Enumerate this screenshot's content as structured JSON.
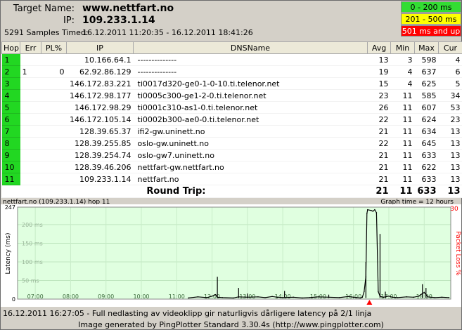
{
  "header": {
    "target_label": "Target Name:",
    "target_value": "www.nettfart.no",
    "ip_label": "IP:",
    "ip_value": "109.233.1.14",
    "samples_label": "5291 Samples Timed:",
    "samples_range": "16.12.2011 11:20:35 - 16.12.2011 18:41:26"
  },
  "legend": [
    {
      "label": "0 - 200 ms",
      "color": "#33dd33"
    },
    {
      "label": "201 - 500 ms",
      "color": "#ffff00"
    },
    {
      "label": "501 ms and up",
      "color": "#ff0000"
    }
  ],
  "table": {
    "columns": [
      "Hop",
      "Err",
      "PL%",
      "IP",
      "DNSName",
      "Avg",
      "Min",
      "Max",
      "Cur"
    ],
    "rows": [
      {
        "hop": "1",
        "err": "",
        "pl": "",
        "ip": "10.166.64.1",
        "dns": "--------------",
        "avg": "13",
        "min": "3",
        "max": "598",
        "cur": "4"
      },
      {
        "hop": "2",
        "err": "1",
        "pl": "0",
        "ip": "62.92.86.129",
        "dns": "--------------",
        "avg": "19",
        "min": "4",
        "max": "637",
        "cur": "6"
      },
      {
        "hop": "3",
        "err": "",
        "pl": "",
        "ip": "146.172.83.221",
        "dns": "ti0017d320-ge0-1-0-10.ti.telenor.net",
        "avg": "15",
        "min": "4",
        "max": "625",
        "cur": "5"
      },
      {
        "hop": "4",
        "err": "",
        "pl": "",
        "ip": "146.172.98.177",
        "dns": "ti0005c300-ge1-2-0.ti.telenor.net",
        "avg": "23",
        "min": "11",
        "max": "585",
        "cur": "34"
      },
      {
        "hop": "5",
        "err": "",
        "pl": "",
        "ip": "146.172.98.29",
        "dns": "ti0001c310-as1-0.ti.telenor.net",
        "avg": "26",
        "min": "11",
        "max": "607",
        "cur": "53"
      },
      {
        "hop": "6",
        "err": "",
        "pl": "",
        "ip": "146.172.105.14",
        "dns": "ti0002b300-ae0-0.ti.telenor.net",
        "avg": "22",
        "min": "11",
        "max": "624",
        "cur": "23"
      },
      {
        "hop": "7",
        "err": "",
        "pl": "",
        "ip": "128.39.65.37",
        "dns": "ifi2-gw.uninett.no",
        "avg": "21",
        "min": "11",
        "max": "634",
        "cur": "13"
      },
      {
        "hop": "8",
        "err": "",
        "pl": "",
        "ip": "128.39.255.85",
        "dns": "oslo-gw.uninett.no",
        "avg": "22",
        "min": "11",
        "max": "645",
        "cur": "13"
      },
      {
        "hop": "9",
        "err": "",
        "pl": "",
        "ip": "128.39.254.74",
        "dns": "oslo-gw7.uninett.no",
        "avg": "21",
        "min": "11",
        "max": "633",
        "cur": "13"
      },
      {
        "hop": "10",
        "err": "",
        "pl": "",
        "ip": "128.39.46.206",
        "dns": "nettfart-gw.nettfart.no",
        "avg": "21",
        "min": "11",
        "max": "622",
        "cur": "13"
      },
      {
        "hop": "11",
        "err": "",
        "pl": "",
        "ip": "109.233.1.14",
        "dns": "nettfart.no",
        "avg": "21",
        "min": "11",
        "max": "633",
        "cur": "13"
      }
    ],
    "round_trip": {
      "label": "Round Trip:",
      "avg": "21",
      "min": "11",
      "max": "633",
      "cur": "13"
    }
  },
  "graph": {
    "title": "nettfart.no (109.233.1.14) hop 11",
    "time_label": "Graph time = 12 hours",
    "right_axis_label": "Packet Loss %",
    "right_axis_max": "30",
    "right_color": "#ff0000",
    "bg_color": "#e0ffe0"
  },
  "chart_data": {
    "type": "line",
    "ylabel": "Latency (ms)",
    "y2label": "Packet Loss %",
    "ylim": [
      0,
      247
    ],
    "y2lim": [
      0,
      30
    ],
    "y_ticks": [
      "0",
      "50 ms",
      "100 ms",
      "150 ms",
      "200 ms",
      "247"
    ],
    "y2_max_label": "30",
    "x_ticks": [
      "07:00",
      "08:00",
      "09:00",
      "10:00",
      "11:00",
      "12:00",
      "13:00",
      "14:00",
      "15:00",
      "16:00",
      "17:00",
      "18:00"
    ],
    "x_range_hours": [
      6.5,
      18.75
    ],
    "marker_time_hours": 16.45,
    "series": [
      {
        "values_desc": "latency",
        "x": [
          11.33,
          11.6,
          11.85,
          12.0,
          12.1,
          12.15,
          12.3,
          12.6,
          12.75,
          13.0,
          13.3,
          13.5,
          13.7,
          13.85,
          14.0,
          14.3,
          14.55,
          14.75,
          15.0,
          15.3,
          15.6,
          15.85,
          16.0,
          16.1,
          16.2,
          16.25,
          16.3,
          16.35,
          16.38,
          16.4,
          16.5,
          16.55,
          16.6,
          16.65,
          16.7,
          16.75,
          16.8,
          16.85,
          17.0,
          17.1,
          17.25,
          17.5,
          17.7,
          17.85,
          17.9,
          18.0,
          18.1,
          18.3,
          18.5,
          18.7
        ],
        "y": [
          3,
          6,
          4,
          8,
          12,
          5,
          4,
          3,
          6,
          5,
          6,
          4,
          7,
          5,
          4,
          5,
          3,
          4,
          6,
          5,
          4,
          7,
          5,
          4,
          3,
          5,
          20,
          60,
          230,
          240,
          238,
          236,
          240,
          232,
          20,
          8,
          6,
          5,
          8,
          5,
          4,
          6,
          5,
          8,
          12,
          18,
          6,
          4,
          5,
          4
        ]
      }
    ],
    "spikes": [
      {
        "x": 12.15,
        "y": 60
      },
      {
        "x": 12.75,
        "y": 30
      },
      {
        "x": 13.0,
        "y": 15
      },
      {
        "x": 14.05,
        "y": 22
      },
      {
        "x": 15.3,
        "y": 12
      },
      {
        "x": 16.35,
        "y": 100
      },
      {
        "x": 16.75,
        "y": 175
      },
      {
        "x": 16.9,
        "y": 20
      },
      {
        "x": 17.95,
        "y": 40
      },
      {
        "x": 18.05,
        "y": 30
      }
    ]
  },
  "footer": {
    "note": "16.12.2011 16:27:05 - Full nedlasting av videoklipp gir naturligvis dårligere latency på 2/1 linja",
    "credit": "Image generated by PingPlotter Standard 3.30.4s (http://www.pingplotter.com)"
  }
}
